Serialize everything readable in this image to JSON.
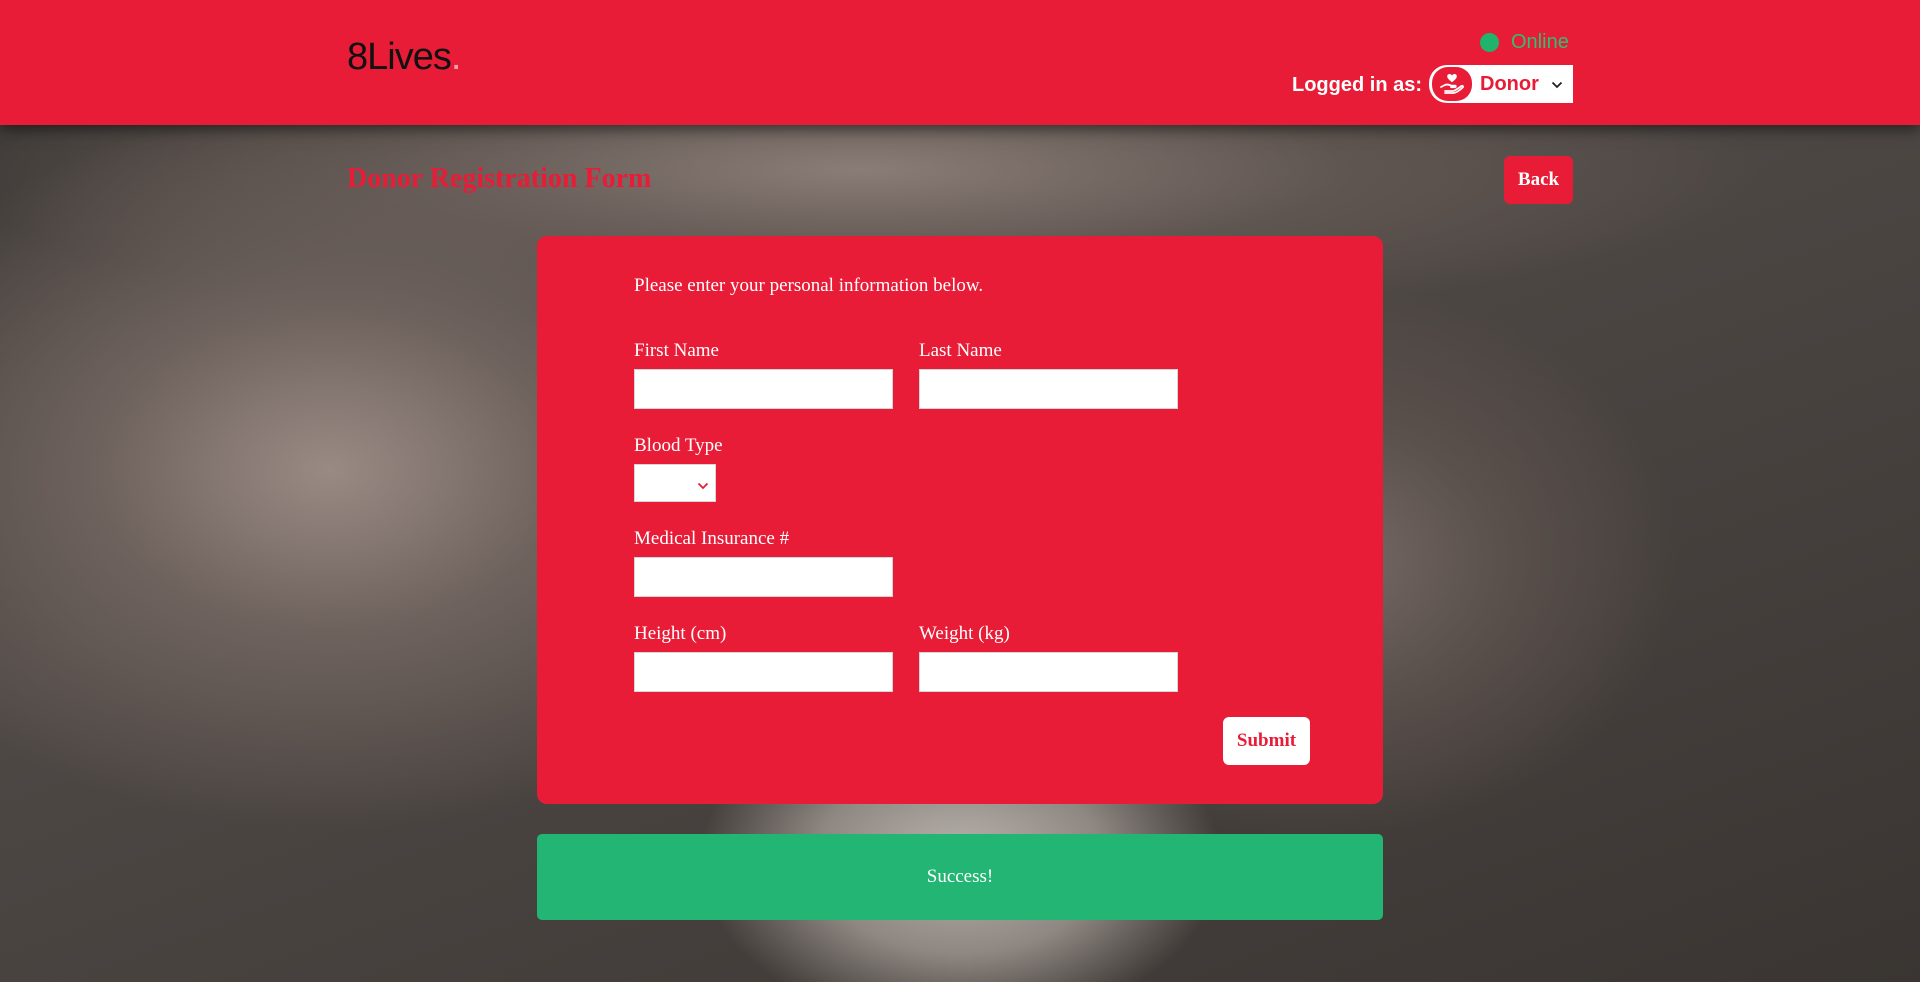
{
  "header": {
    "logo_text": "8Lives",
    "logo_dot": ".",
    "status_text": "Online",
    "logged_in_label": "Logged in as:",
    "role_selected": "Donor"
  },
  "page": {
    "title": "Donor Registration Form",
    "back_label": "Back"
  },
  "form": {
    "intro": "Please enter your personal information below.",
    "first_name": {
      "label": "First Name",
      "value": ""
    },
    "last_name": {
      "label": "Last Name",
      "value": ""
    },
    "blood_type": {
      "label": "Blood Type",
      "selected": ""
    },
    "medical_insurance": {
      "label": "Medical Insurance #",
      "value": ""
    },
    "height": {
      "label": "Height (cm)",
      "value": ""
    },
    "weight": {
      "label": "Weight (kg)",
      "value": ""
    },
    "submit_label": "Submit"
  },
  "message": {
    "success_text": "Success!"
  },
  "colors": {
    "brand_red": "#e91c37",
    "success_green": "#22b573",
    "online_green": "#1fb36b"
  },
  "icons": {
    "role": "heart-hand-icon",
    "status": "status-dot-icon",
    "dropdown": "chevron-down-icon"
  }
}
